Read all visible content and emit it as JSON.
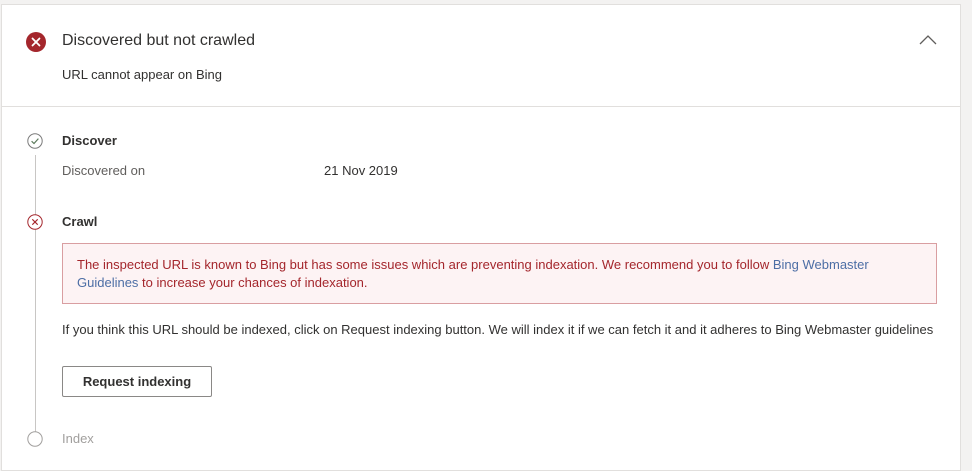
{
  "header": {
    "status_icon": "error-circle-icon",
    "title": "Discovered but not crawled",
    "subtitle": "URL cannot appear on Bing",
    "collapse_icon": "chevron-up-icon"
  },
  "steps": {
    "discover": {
      "label": "Discover",
      "status_icon": "check-circle-icon",
      "field_label": "Discovered on",
      "field_value": "21 Nov 2019"
    },
    "crawl": {
      "label": "Crawl",
      "status_icon": "x-circle-icon",
      "alert_text_before": "The inspected URL is known to Bing but has some issues which are preventing indexation. We recommend you to follow ",
      "alert_link": "Bing Webmaster Guidelines",
      "alert_text_after": " to increase your chances of indexation.",
      "note": "If you think this URL should be indexed, click on Request indexing button. We will index it if we can fetch it and it adheres to Bing Webmaster guidelines",
      "button_label": "Request indexing"
    },
    "index": {
      "label": "Index",
      "status_icon": "empty-circle-icon"
    }
  },
  "colors": {
    "error": "#a4262c",
    "success_outline": "#7a7a7a",
    "link": "#4d6ea5"
  }
}
